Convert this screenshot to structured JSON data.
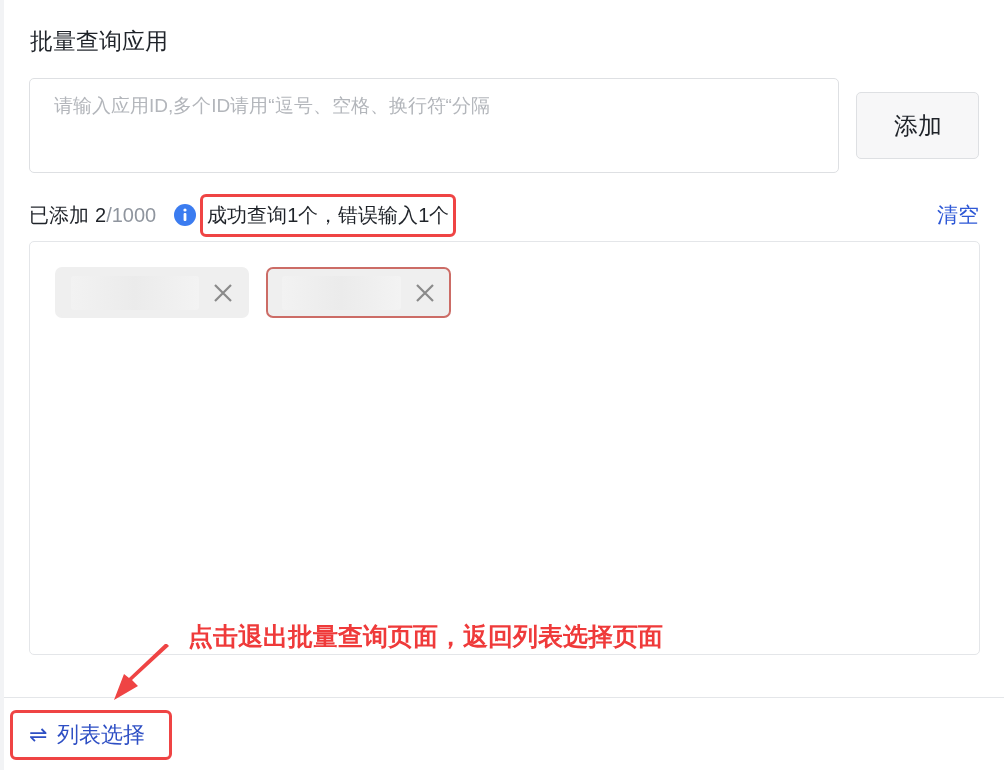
{
  "title": "批量查询应用",
  "input": {
    "placeholder": "请输入应用ID,多个ID请用“逗号、空格、换行符“分隔"
  },
  "add_button": "添加",
  "count": {
    "label": "已添加",
    "added": "2",
    "limit": "/1000"
  },
  "status": {
    "text": "成功查询1个，错误输入1个",
    "highlighted": true
  },
  "clear_link": "清空",
  "tags": [
    {
      "error": false
    },
    {
      "error": true
    }
  ],
  "footer_button": {
    "icon": "⇌",
    "label": "列表选择",
    "highlighted": true
  },
  "annotation": {
    "text": "点击退出批量查询页面，返回列表选择页面"
  }
}
